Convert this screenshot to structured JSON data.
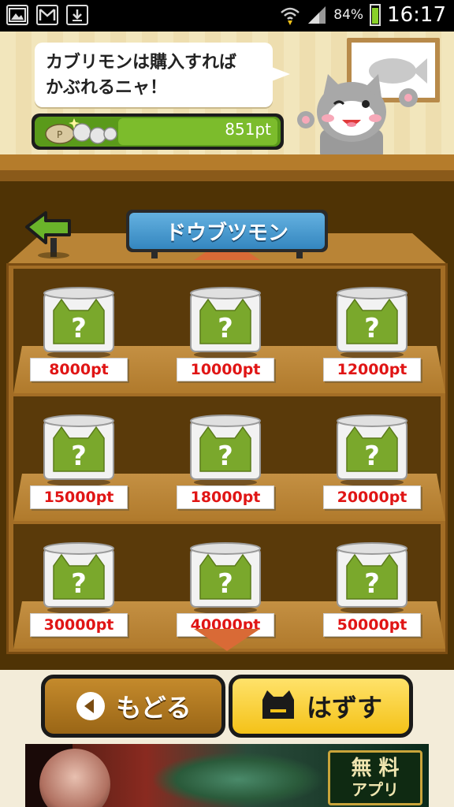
{
  "status_bar": {
    "left_icons": [
      "gallery-icon",
      "gmail-icon",
      "download-icon"
    ],
    "battery_percent": "84%",
    "time": "16:17"
  },
  "header": {
    "speech_lines": [
      "カブリモンは購入すれば",
      "かぶれるニャ！"
    ],
    "points": "851pt"
  },
  "category": {
    "title": "ドウブツモン"
  },
  "items": [
    {
      "price": "8000pt"
    },
    {
      "price": "10000pt"
    },
    {
      "price": "12000pt"
    },
    {
      "price": "15000pt"
    },
    {
      "price": "18000pt"
    },
    {
      "price": "20000pt"
    },
    {
      "price": "30000pt"
    },
    {
      "price": "40000pt"
    },
    {
      "price": "50000pt"
    }
  ],
  "buttons": {
    "back_label": "もどる",
    "remove_label": "はずす"
  },
  "ad": {
    "badge_line1": "無 料",
    "badge_line2": "アプリ"
  },
  "colors": {
    "price_red": "#e01515",
    "cat_green": "#7aa82c",
    "button_yellow": "#f4c218",
    "button_brown": "#9a6616",
    "sign_blue": "#3486bf"
  }
}
